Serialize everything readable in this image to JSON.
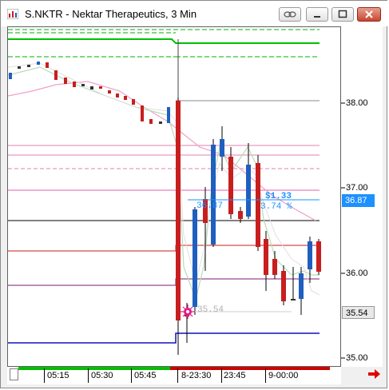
{
  "window": {
    "title": "S.NKTR - Nektar Therapeutics, 3 Min"
  },
  "icons": {
    "app": "chart-app-icon",
    "link": "link-icon",
    "minimize": "minimize-icon",
    "maximize": "maximize-icon",
    "close": "close-icon",
    "scroll_right": "red-arrow-right-icon"
  },
  "price_axis": {
    "labels": [
      "38.00",
      "37.00",
      "36.00",
      "35.00"
    ]
  },
  "badges": {
    "current_price": "36.87",
    "entry_price": "35.54"
  },
  "annotations": {
    "profit_dollars": "$1.33",
    "profit_percent": "3.74 %",
    "entry_line_label": "36.87",
    "entry_marker_label": "35.54"
  },
  "time_axis": {
    "labels": [
      "05:15",
      "05:30",
      "05:45",
      "8-23:30",
      "23:45",
      "9-00:00"
    ]
  },
  "colors": {
    "up": "#1f5fbf",
    "down": "#c81e1e",
    "accent_blue": "#1e90ff",
    "green_line": "#00c000",
    "pink_line": "#e060a0"
  }
}
